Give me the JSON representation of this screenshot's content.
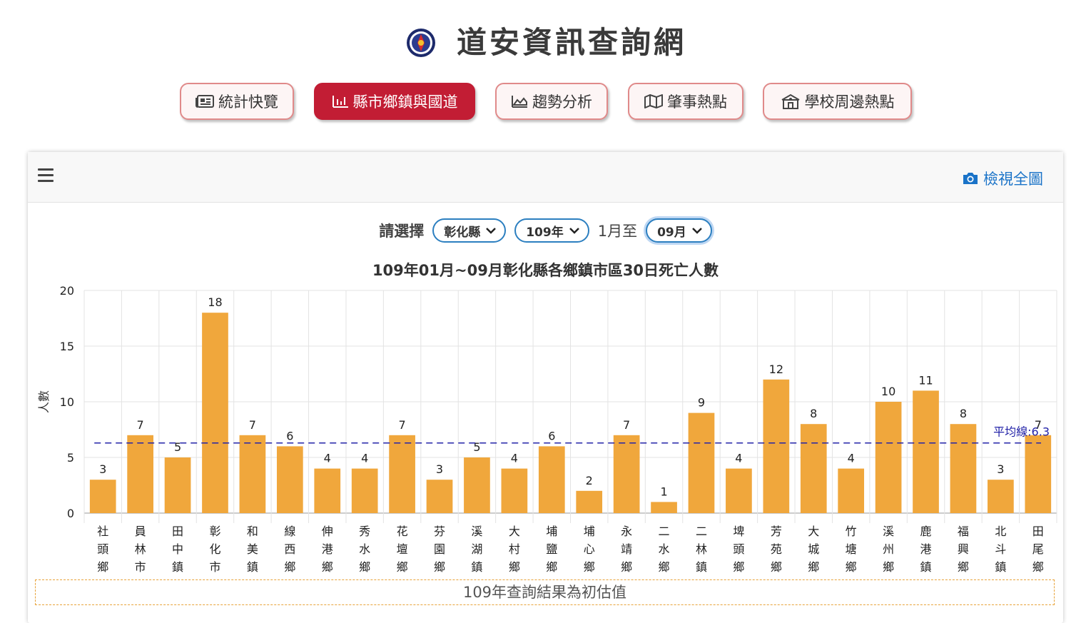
{
  "header": {
    "title": "道安資訊查詢網"
  },
  "nav": {
    "items": [
      {
        "label": "統計快覽",
        "icon": "newspaper-icon",
        "active": false
      },
      {
        "label": "縣市鄉鎮與國道",
        "icon": "bar-chart-icon",
        "active": true
      },
      {
        "label": "趨勢分析",
        "icon": "area-chart-icon",
        "active": false
      },
      {
        "label": "肇事熱點",
        "icon": "map-icon",
        "active": false
      },
      {
        "label": "學校周邊熱點",
        "icon": "school-icon",
        "active": false
      }
    ]
  },
  "panel": {
    "view_full_label": "檢視全圖",
    "selector": {
      "label": "請選擇",
      "county": "彰化縣",
      "year": "109年",
      "range_text": "1月至",
      "month": "09月"
    },
    "note": "109年查詢結果為初估值"
  },
  "colors": {
    "bar": "#f0a73c",
    "avg_line": "#2323a8",
    "accent": "#c21d34",
    "link": "#1a73c8"
  },
  "chart_data": {
    "type": "bar",
    "title": "109年01月~09月彰化縣各鄉鎮市區30日死亡人數",
    "ylabel": "人數",
    "xlabel": "",
    "ylim": [
      0,
      20
    ],
    "yticks": [
      0,
      5,
      10,
      15,
      20
    ],
    "grid": true,
    "categories": [
      "社頭鄉",
      "員林市",
      "田中鎮",
      "彰化市",
      "和美鎮",
      "線西鄉",
      "伸港鄉",
      "秀水鄉",
      "花壇鄉",
      "芬園鄉",
      "溪湖鎮",
      "大村鄉",
      "埔鹽鄉",
      "埔心鄉",
      "永靖鄉",
      "二水鄉",
      "二林鎮",
      "埤頭鄉",
      "芳苑鄉",
      "大城鄉",
      "竹塘鄉",
      "溪州鄉",
      "鹿港鎮",
      "福興鄉",
      "北斗鎮",
      "田尾鄉"
    ],
    "values": [
      3,
      7,
      5,
      18,
      7,
      6,
      4,
      4,
      7,
      3,
      5,
      4,
      6,
      2,
      7,
      1,
      9,
      4,
      12,
      8,
      4,
      10,
      11,
      8,
      3,
      7
    ],
    "average": {
      "label": "平均線:6.3",
      "value": 6.3
    }
  }
}
